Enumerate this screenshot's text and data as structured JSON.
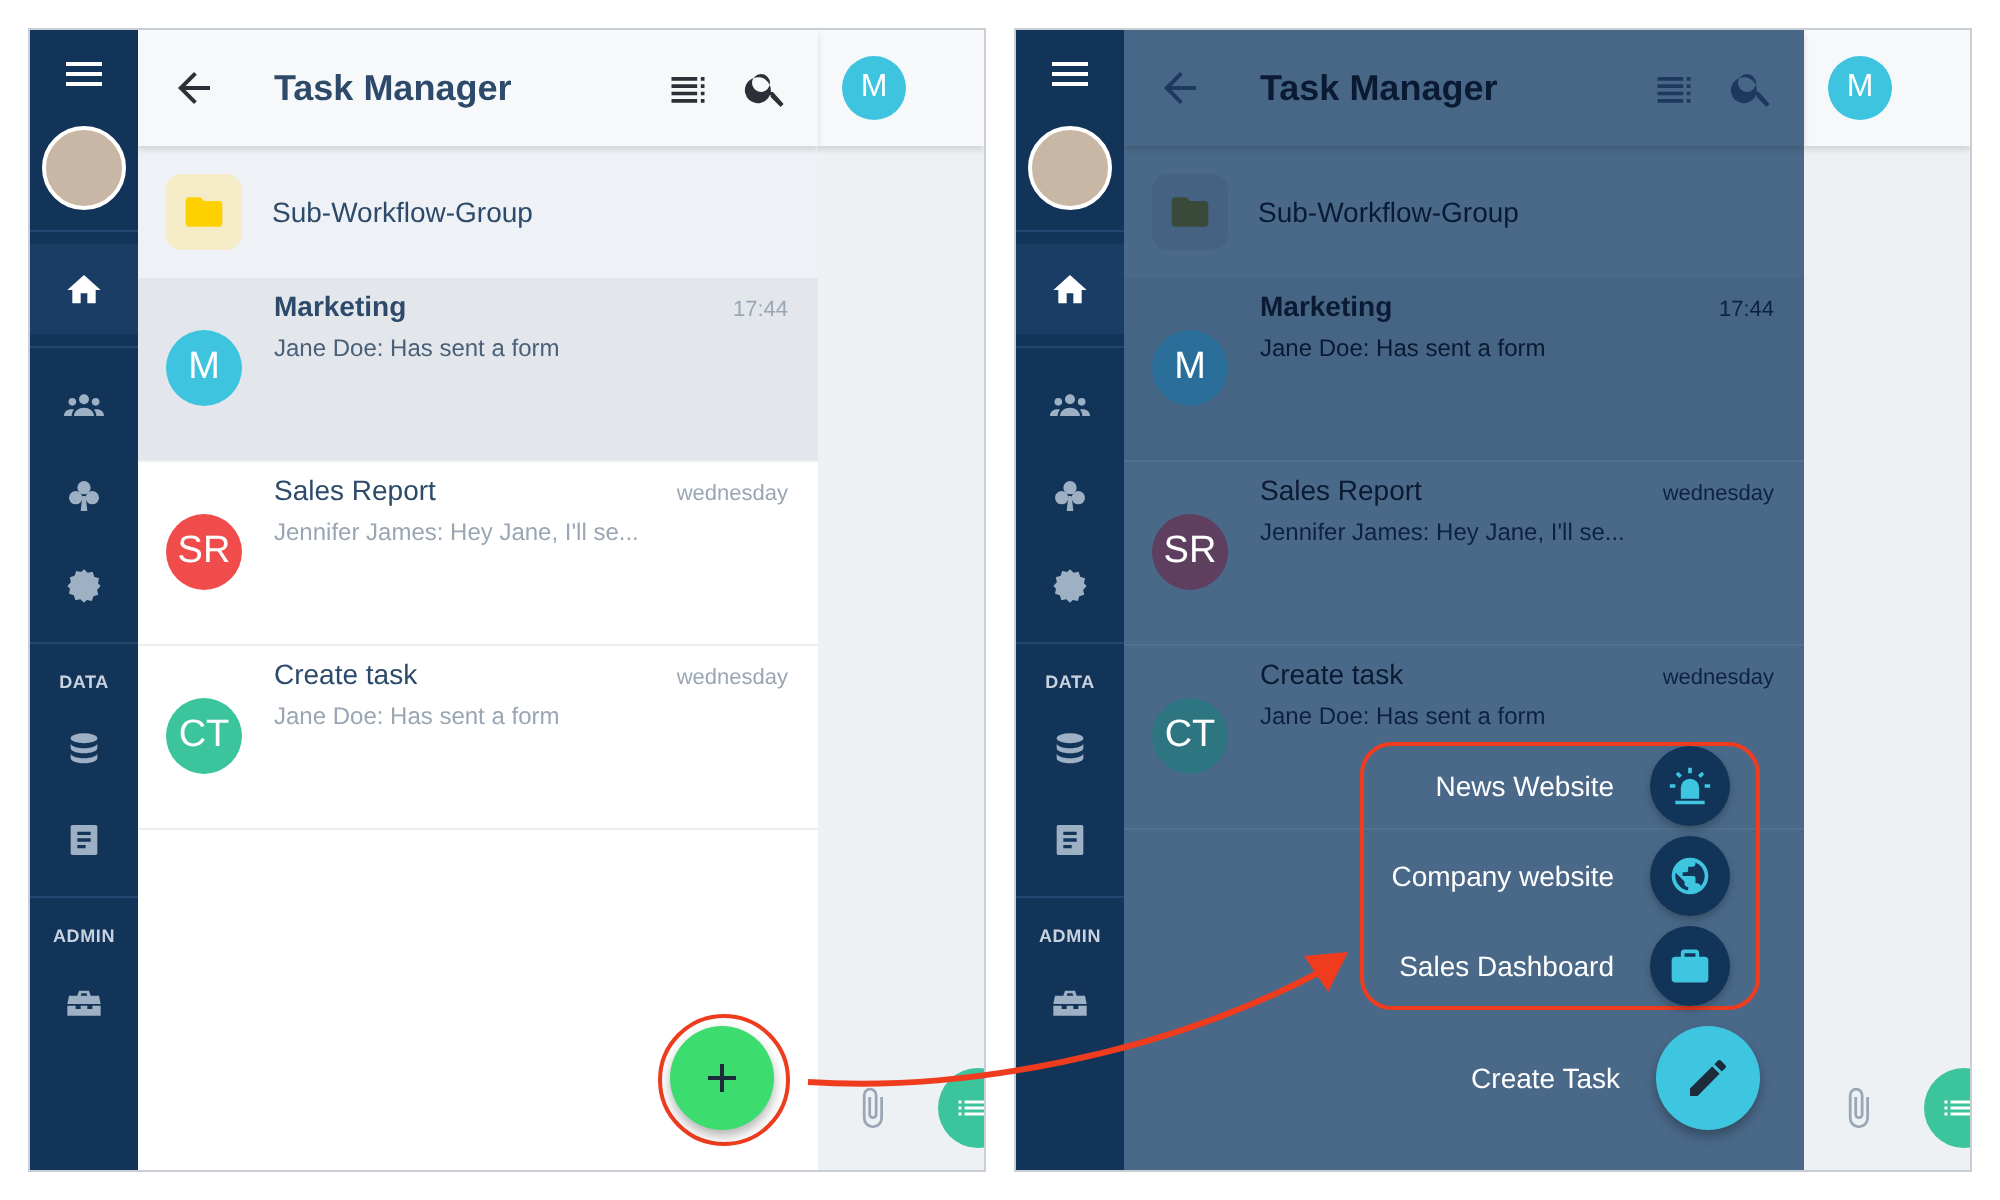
{
  "panels": [
    {
      "dimmed": false,
      "sidebar": {
        "groups": [
          {
            "items": [
              {
                "kind": "home",
                "selected": true
              }
            ]
          },
          {
            "items": [
              {
                "kind": "people",
                "selected": false
              },
              {
                "kind": "club",
                "selected": false
              },
              {
                "kind": "gear",
                "selected": false
              }
            ]
          },
          {
            "label": "DATA",
            "items": [
              {
                "kind": "database",
                "selected": false
              },
              {
                "kind": "document",
                "selected": false
              }
            ]
          },
          {
            "label": "ADMIN",
            "items": [
              {
                "kind": "toolbox",
                "selected": false
              }
            ]
          }
        ]
      },
      "header": {
        "title": "Task Manager"
      },
      "folder": {
        "name": "Sub-Workflow-Group"
      },
      "chats": [
        {
          "initials": "M",
          "color": "#3fc4e0",
          "title": "Marketing",
          "time": "17:44",
          "preview": "Jane Doe: Has sent a form",
          "selected": true
        },
        {
          "initials": "SR",
          "color": "#f04c4c",
          "title": "Sales Report",
          "time": "wednesday",
          "preview": "Jennifer James: Hey Jane, I'll se...",
          "selected": false
        },
        {
          "initials": "CT",
          "color": "#3cc49c",
          "title": "Create task",
          "time": "wednesday",
          "preview": "Jane Doe: Has sent a form",
          "selected": false
        }
      ],
      "side_pane": {
        "avatar": "M"
      },
      "fab": {
        "kind": "add",
        "highlighted": true
      }
    },
    {
      "dimmed": true,
      "sidebar": {
        "groups": [
          {
            "items": [
              {
                "kind": "home",
                "selected": true
              }
            ]
          },
          {
            "items": [
              {
                "kind": "people",
                "selected": false
              },
              {
                "kind": "club",
                "selected": false
              },
              {
                "kind": "gear",
                "selected": false
              }
            ]
          },
          {
            "label": "DATA",
            "items": [
              {
                "kind": "database",
                "selected": false
              },
              {
                "kind": "document",
                "selected": false
              }
            ]
          },
          {
            "label": "ADMIN",
            "items": [
              {
                "kind": "toolbox",
                "selected": false
              }
            ]
          }
        ]
      },
      "header": {
        "title": "Task Manager"
      },
      "folder": {
        "name": "Sub-Workflow-Group"
      },
      "chats": [
        {
          "initials": "M",
          "color": "#2a6f99",
          "title": "Marketing",
          "time": "17:44",
          "preview": "Jane Doe: Has sent a form",
          "selected": true
        },
        {
          "initials": "SR",
          "color": "#5e3f5f",
          "title": "Sales Report",
          "time": "wednesday",
          "preview": "Jennifer James: Hey Jane, I'll se...",
          "selected": false
        },
        {
          "initials": "CT",
          "color": "#2d7580",
          "title": "Create task",
          "time": "wednesday",
          "preview": "Jane Doe: Has sent a form",
          "selected": false
        }
      ],
      "side_pane": {
        "avatar": "M"
      },
      "fab": {
        "kind": "edit",
        "label": "Create Task",
        "highlighted": false
      },
      "speed_dial": {
        "highlighted": true,
        "actions": [
          {
            "label": "News Website",
            "kind": "siren"
          },
          {
            "label": "Company website",
            "kind": "globe"
          },
          {
            "label": "Sales Dashboard",
            "kind": "briefcase"
          }
        ]
      }
    }
  ]
}
